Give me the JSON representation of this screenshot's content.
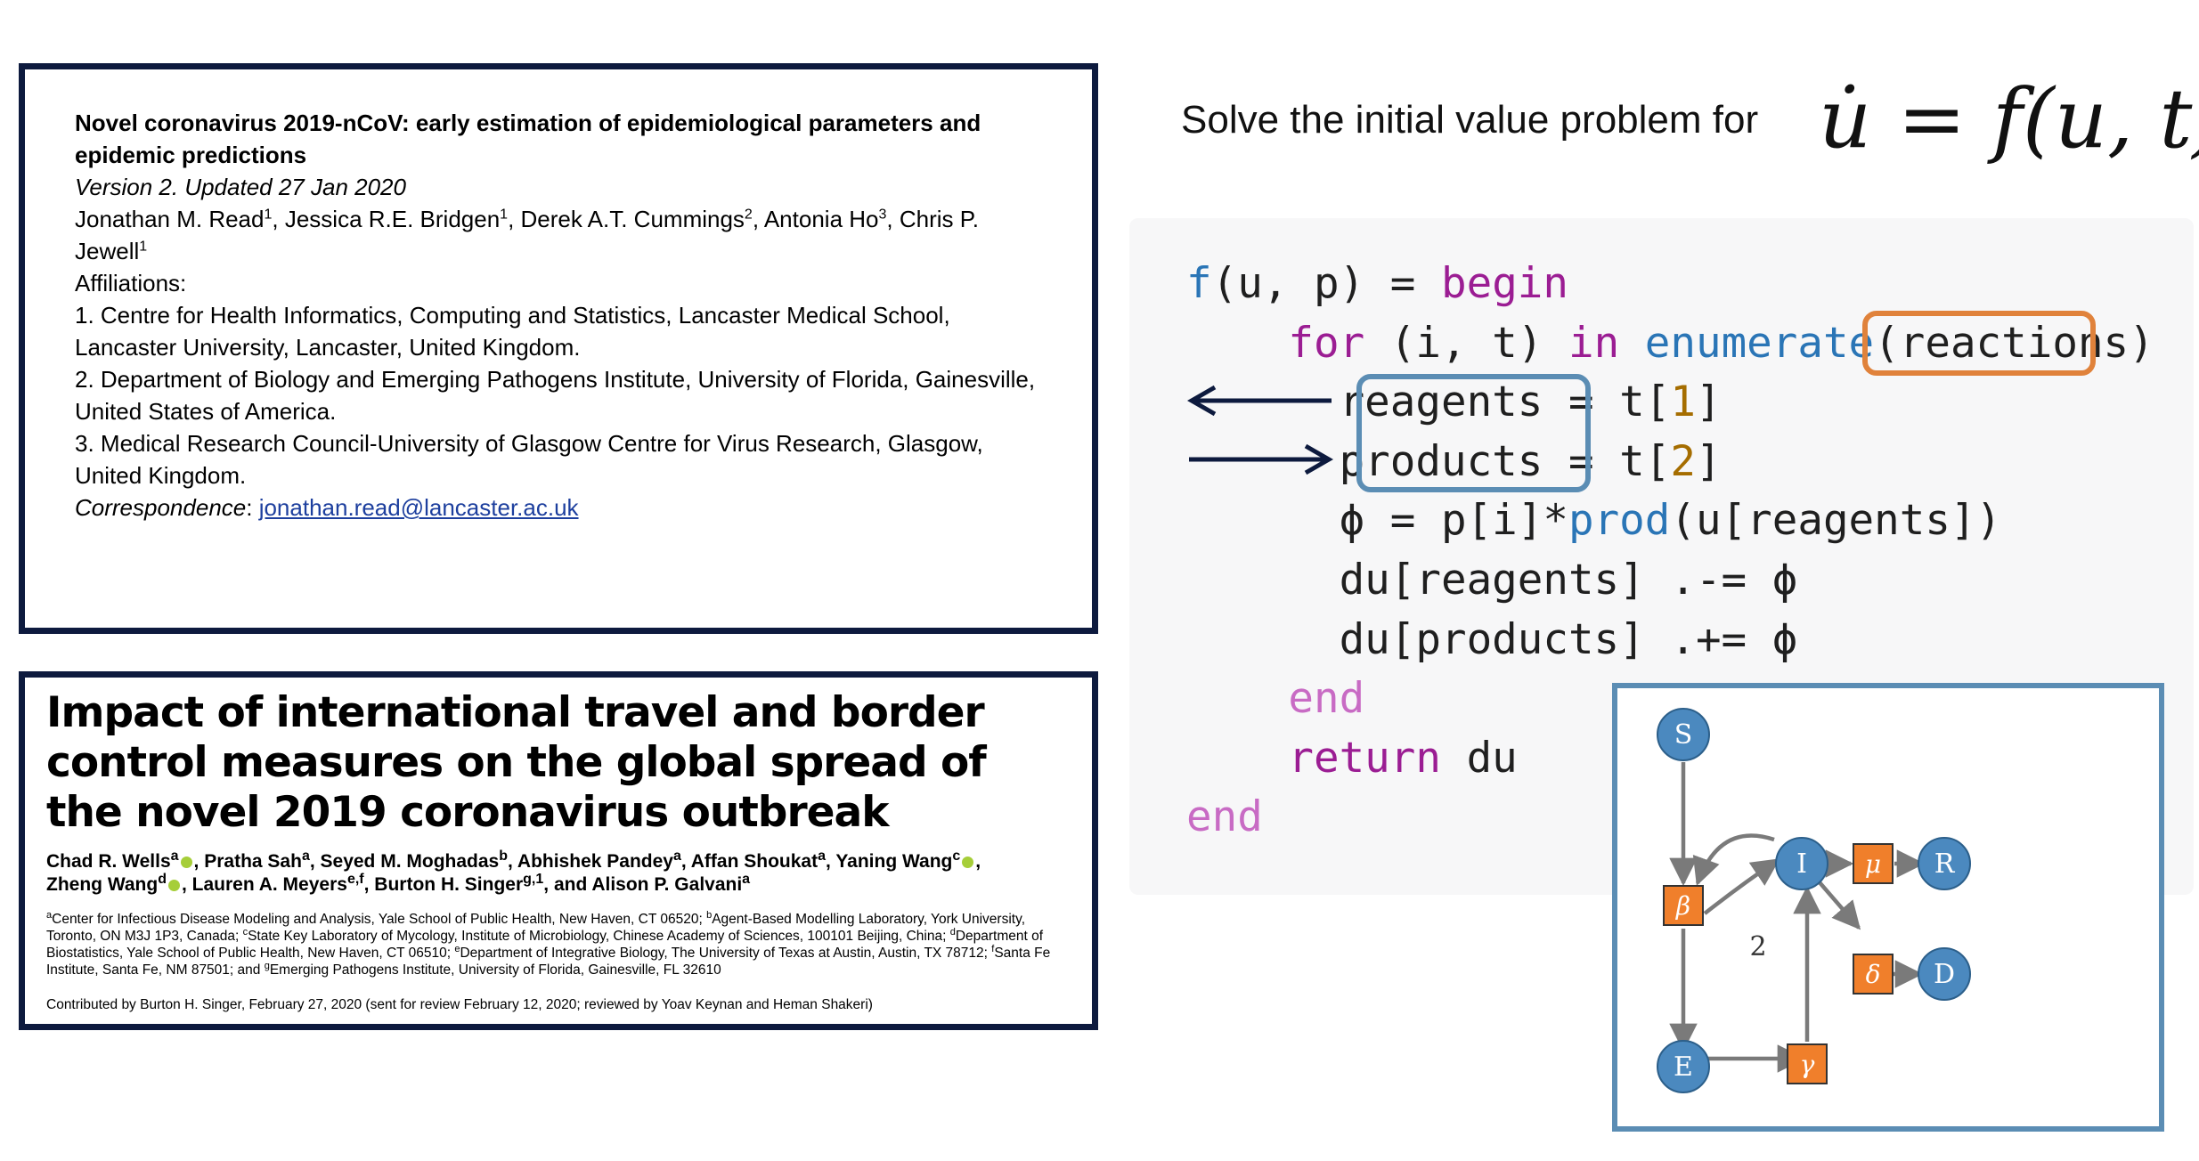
{
  "paper1": {
    "title": "Novel coronavirus 2019-nCoV: early estimation of epidemiological parameters and epidemic predictions",
    "version": "Version 2. Updated 27 Jan 2020",
    "authors": [
      {
        "name": "Jonathan M. Read",
        "sup": "1"
      },
      {
        "name": "Jessica R.E. Bridgen",
        "sup": "1"
      },
      {
        "name": "Derek A.T. Cummings",
        "sup": "2"
      },
      {
        "name": "Antonia Ho",
        "sup": "3"
      },
      {
        "name": "Chris P. Jewell",
        "sup": "1"
      }
    ],
    "affiliations_label": "Affiliations:",
    "affiliations": [
      "1. Centre for Health Informatics, Computing and Statistics, Lancaster Medical School, Lancaster University, Lancaster, United Kingdom.",
      "2. Department of Biology and Emerging Pathogens Institute, University of Florida, Gainesville, United States of America.",
      "3. Medical Research Council-University of Glasgow Centre for Virus Research, Glasgow, United Kingdom."
    ],
    "correspondence_label": "Correspondence",
    "email": "jonathan.read@lancaster.ac.uk"
  },
  "paper2": {
    "title": "Impact of international travel and border control measures on the global spread of the novel 2019 coronavirus outbreak",
    "authors_line1": [
      {
        "name": "Chad R. Wells",
        "sup": "a",
        "orcid": true
      },
      {
        "name": "Pratha Sah",
        "sup": "a",
        "orcid": false
      },
      {
        "name": "Seyed M. Moghadas",
        "sup": "b",
        "orcid": false
      },
      {
        "name": "Abhishek Pandey",
        "sup": "a",
        "orcid": false
      },
      {
        "name": "Affan Shoukat",
        "sup": "a",
        "orcid": false
      },
      {
        "name": "Yaning Wang",
        "sup": "c",
        "orcid": true
      }
    ],
    "authors_line2": [
      {
        "name": "Zheng Wang",
        "sup": "d",
        "orcid": true
      },
      {
        "name": "Lauren A. Meyers",
        "sup": "e,f",
        "orcid": false
      },
      {
        "name": "Burton H. Singer",
        "sup": "g,1",
        "orcid": false
      },
      {
        "name": "and Alison P. Galvani",
        "sup": "a",
        "orcid": false
      }
    ],
    "affiliations": [
      {
        "sup": "a",
        "text": "Center for Infectious Disease Modeling and Analysis, Yale School of Public Health, New Haven, CT 06520;"
      },
      {
        "sup": "b",
        "text": "Agent-Based Modelling Laboratory, York University, Toronto, ON M3J 1P3, Canada;"
      },
      {
        "sup": "c",
        "text": "State Key Laboratory of Mycology, Institute of Microbiology, Chinese Academy of Sciences, 100101 Beijing, China;"
      },
      {
        "sup": "d",
        "text": "Department of Biostatistics, Yale School of Public Health, New Haven, CT 06510;"
      },
      {
        "sup": "e",
        "text": "Department of Integrative Biology, The University of Texas at Austin, Austin, TX 78712;"
      },
      {
        "sup": "f",
        "text": "Santa Fe Institute, Santa Fe, NM 87501; and"
      },
      {
        "sup": "g",
        "text": "Emerging Pathogens Institute, University of Florida, Gainesville, FL 32610"
      }
    ],
    "contributed": "Contributed by Burton H. Singer, February 27, 2020 (sent for review February 12, 2020; reviewed by Yoav Keynan and Heman Shakeri)"
  },
  "problem": {
    "text": "Solve the initial value problem for",
    "equation": "u̇ = f(u, t)"
  },
  "code": {
    "lines": [
      [
        [
          "fn",
          "f"
        ],
        [
          "",
          "(u, p) = "
        ],
        [
          "kw",
          "begin"
        ]
      ],
      [
        [
          "",
          "    "
        ],
        [
          "kw",
          "for"
        ],
        [
          "",
          " (i, t) "
        ],
        [
          "kw",
          "in"
        ],
        [
          "",
          " "
        ],
        [
          "fn",
          "enumerate"
        ],
        [
          "",
          "(reactions)"
        ]
      ],
      [
        [
          "",
          "      reagents = t["
        ],
        [
          "num",
          "1"
        ],
        [
          "",
          "]"
        ]
      ],
      [
        [
          "",
          "      products = t["
        ],
        [
          "num",
          "2"
        ],
        [
          "",
          "]"
        ]
      ],
      [
        [
          "",
          "      ϕ = p[i]*"
        ],
        [
          "fn",
          "prod"
        ],
        [
          "",
          "(u[reagents])"
        ]
      ],
      [
        [
          "",
          "      du[reagents] .-= ϕ"
        ]
      ],
      [
        [
          "",
          "      du[products] .+= ϕ"
        ]
      ],
      [
        [
          "",
          "    "
        ],
        [
          "kw2",
          "end"
        ]
      ],
      [
        [
          "",
          "    "
        ],
        [
          "kw",
          "return"
        ],
        [
          "",
          " du"
        ]
      ],
      [
        [
          "kw2",
          "end"
        ]
      ]
    ]
  },
  "network": {
    "species": [
      "S",
      "I",
      "R",
      "D",
      "E"
    ],
    "rates": [
      "β",
      "μ",
      "δ",
      "γ"
    ],
    "stoichiometry_label": "2"
  }
}
